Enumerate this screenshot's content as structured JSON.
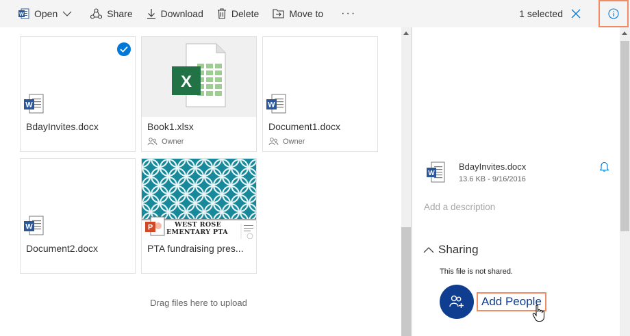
{
  "toolbar": {
    "open_label": "Open",
    "share_label": "Share",
    "download_label": "Download",
    "delete_label": "Delete",
    "moveto_label": "Move to",
    "more_label": "···",
    "selected_label": "1 selected"
  },
  "files": [
    {
      "name": "BdayInvites.docx",
      "type": "word",
      "selected": true,
      "owner": ""
    },
    {
      "name": "Book1.xlsx",
      "type": "excel",
      "selected": false,
      "owner": "Owner"
    },
    {
      "name": "Document1.docx",
      "type": "word",
      "selected": false,
      "owner": "Owner"
    },
    {
      "name": "Document2.docx",
      "type": "word",
      "selected": false,
      "owner": ""
    },
    {
      "name": "PTA fundraising pres...",
      "type": "powerpoint",
      "selected": false,
      "owner": ""
    }
  ],
  "pta_thumb": {
    "line1": "WEST ROSE",
    "line2": "EMENTARY PTA"
  },
  "upload_hint": "Drag files here to upload",
  "details": {
    "file_name": "BdayInvites.docx",
    "file_meta": "13.6 KB - 9/16/2016",
    "description_placeholder": "Add a description",
    "sharing_title": "Sharing",
    "not_shared": "This file is not shared.",
    "add_people": "Add People"
  },
  "colors": {
    "accent": "#0078d7",
    "highlight": "#f08b64",
    "word": "#2b579a",
    "excel": "#217346",
    "powerpoint": "#d24726",
    "add_people": "#0f3d8f"
  }
}
